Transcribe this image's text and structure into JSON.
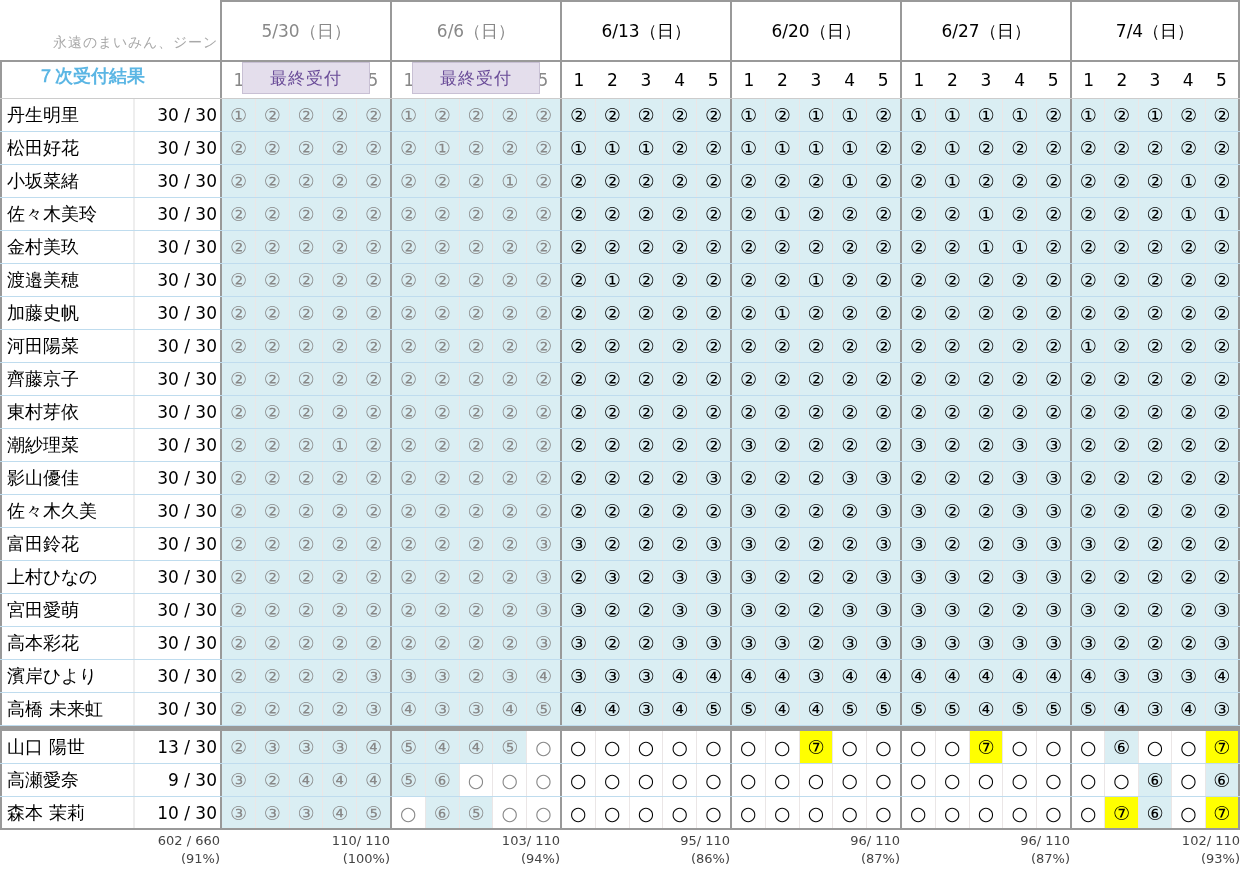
{
  "caption": "永遠のまいみん、ジーン",
  "title": "７次受付結果",
  "days": [
    {
      "label": "5/30（日）",
      "past": true,
      "slots": [
        "1",
        "5"
      ],
      "badge": "最終受付"
    },
    {
      "label": "6/6（日）",
      "past": true,
      "slots": [
        "1",
        "5"
      ],
      "badge": "最終受付"
    },
    {
      "label": "6/13（日）",
      "past": false,
      "slots": [
        "1",
        "2",
        "3",
        "4",
        "5"
      ]
    },
    {
      "label": "6/20（日）",
      "past": false,
      "slots": [
        "1",
        "2",
        "3",
        "4",
        "5"
      ]
    },
    {
      "label": "6/27（日）",
      "past": false,
      "slots": [
        "1",
        "2",
        "3",
        "4",
        "5"
      ]
    },
    {
      "label": "7/4（日）",
      "past": false,
      "slots": [
        "1",
        "2",
        "3",
        "4",
        "5"
      ]
    }
  ],
  "groups": [
    {
      "rows": [
        {
          "name": "丹生明里",
          "score": "30 / 30",
          "marks": [
            [
              "①",
              "②",
              "②",
              "②",
              "②"
            ],
            [
              "①",
              "②",
              "②",
              "②",
              "②"
            ],
            [
              "②",
              "②",
              "②",
              "②",
              "②"
            ],
            [
              "①",
              "②",
              "①",
              "①",
              "②"
            ],
            [
              "①",
              "①",
              "①",
              "①",
              "②"
            ],
            [
              "①",
              "②",
              "①",
              "②",
              "②"
            ]
          ]
        },
        {
          "name": "松田好花",
          "score": "30 / 30",
          "marks": [
            [
              "②",
              "②",
              "②",
              "②",
              "②"
            ],
            [
              "②",
              "①",
              "②",
              "②",
              "②"
            ],
            [
              "①",
              "①",
              "①",
              "②",
              "②"
            ],
            [
              "①",
              "①",
              "①",
              "①",
              "②"
            ],
            [
              "②",
              "①",
              "②",
              "②",
              "②"
            ],
            [
              "②",
              "②",
              "②",
              "②",
              "②"
            ]
          ]
        },
        {
          "name": "小坂菜緒",
          "score": "30 / 30",
          "marks": [
            [
              "②",
              "②",
              "②",
              "②",
              "②"
            ],
            [
              "②",
              "②",
              "②",
              "①",
              "②"
            ],
            [
              "②",
              "②",
              "②",
              "②",
              "②"
            ],
            [
              "②",
              "②",
              "②",
              "①",
              "②"
            ],
            [
              "②",
              "①",
              "②",
              "②",
              "②"
            ],
            [
              "②",
              "②",
              "②",
              "①",
              "②"
            ]
          ]
        },
        {
          "name": "佐々木美玲",
          "score": "30 / 30",
          "marks": [
            [
              "②",
              "②",
              "②",
              "②",
              "②"
            ],
            [
              "②",
              "②",
              "②",
              "②",
              "②"
            ],
            [
              "②",
              "②",
              "②",
              "②",
              "②"
            ],
            [
              "②",
              "①",
              "②",
              "②",
              "②"
            ],
            [
              "②",
              "②",
              "①",
              "②",
              "②"
            ],
            [
              "②",
              "②",
              "②",
              "①",
              "①"
            ]
          ]
        },
        {
          "name": "金村美玖",
          "score": "30 / 30",
          "marks": [
            [
              "②",
              "②",
              "②",
              "②",
              "②"
            ],
            [
              "②",
              "②",
              "②",
              "②",
              "②"
            ],
            [
              "②",
              "②",
              "②",
              "②",
              "②"
            ],
            [
              "②",
              "②",
              "②",
              "②",
              "②"
            ],
            [
              "②",
              "②",
              "①",
              "①",
              "②"
            ],
            [
              "②",
              "②",
              "②",
              "②",
              "②"
            ]
          ]
        },
        {
          "name": "渡邉美穂",
          "score": "30 / 30",
          "marks": [
            [
              "②",
              "②",
              "②",
              "②",
              "②"
            ],
            [
              "②",
              "②",
              "②",
              "②",
              "②"
            ],
            [
              "②",
              "①",
              "②",
              "②",
              "②"
            ],
            [
              "②",
              "②",
              "①",
              "②",
              "②"
            ],
            [
              "②",
              "②",
              "②",
              "②",
              "②"
            ],
            [
              "②",
              "②",
              "②",
              "②",
              "②"
            ]
          ]
        },
        {
          "name": "加藤史帆",
          "score": "30 / 30",
          "marks": [
            [
              "②",
              "②",
              "②",
              "②",
              "②"
            ],
            [
              "②",
              "②",
              "②",
              "②",
              "②"
            ],
            [
              "②",
              "②",
              "②",
              "②",
              "②"
            ],
            [
              "②",
              "①",
              "②",
              "②",
              "②"
            ],
            [
              "②",
              "②",
              "②",
              "②",
              "②"
            ],
            [
              "②",
              "②",
              "②",
              "②",
              "②"
            ]
          ]
        },
        {
          "name": "河田陽菜",
          "score": "30 / 30",
          "marks": [
            [
              "②",
              "②",
              "②",
              "②",
              "②"
            ],
            [
              "②",
              "②",
              "②",
              "②",
              "②"
            ],
            [
              "②",
              "②",
              "②",
              "②",
              "②"
            ],
            [
              "②",
              "②",
              "②",
              "②",
              "②"
            ],
            [
              "②",
              "②",
              "②",
              "②",
              "②"
            ],
            [
              "①",
              "②",
              "②",
              "②",
              "②"
            ]
          ]
        },
        {
          "name": "齊藤京子",
          "score": "30 / 30",
          "marks": [
            [
              "②",
              "②",
              "②",
              "②",
              "②"
            ],
            [
              "②",
              "②",
              "②",
              "②",
              "②"
            ],
            [
              "②",
              "②",
              "②",
              "②",
              "②"
            ],
            [
              "②",
              "②",
              "②",
              "②",
              "②"
            ],
            [
              "②",
              "②",
              "②",
              "②",
              "②"
            ],
            [
              "②",
              "②",
              "②",
              "②",
              "②"
            ]
          ]
        },
        {
          "name": "東村芽依",
          "score": "30 / 30",
          "marks": [
            [
              "②",
              "②",
              "②",
              "②",
              "②"
            ],
            [
              "②",
              "②",
              "②",
              "②",
              "②"
            ],
            [
              "②",
              "②",
              "②",
              "②",
              "②"
            ],
            [
              "②",
              "②",
              "②",
              "②",
              "②"
            ],
            [
              "②",
              "②",
              "②",
              "②",
              "②"
            ],
            [
              "②",
              "②",
              "②",
              "②",
              "②"
            ]
          ]
        },
        {
          "name": "潮紗理菜",
          "score": "30 / 30",
          "marks": [
            [
              "②",
              "②",
              "②",
              "①",
              "②"
            ],
            [
              "②",
              "②",
              "②",
              "②",
              "②"
            ],
            [
              "②",
              "②",
              "②",
              "②",
              "②"
            ],
            [
              "③",
              "②",
              "②",
              "②",
              "②"
            ],
            [
              "③",
              "②",
              "②",
              "③",
              "③"
            ],
            [
              "②",
              "②",
              "②",
              "②",
              "②"
            ]
          ]
        },
        {
          "name": "影山優佳",
          "score": "30 / 30",
          "marks": [
            [
              "②",
              "②",
              "②",
              "②",
              "②"
            ],
            [
              "②",
              "②",
              "②",
              "②",
              "②"
            ],
            [
              "②",
              "②",
              "②",
              "②",
              "③"
            ],
            [
              "②",
              "②",
              "②",
              "③",
              "③"
            ],
            [
              "②",
              "②",
              "②",
              "③",
              "③"
            ],
            [
              "②",
              "②",
              "②",
              "②",
              "②"
            ]
          ]
        },
        {
          "name": "佐々木久美",
          "score": "30 / 30",
          "marks": [
            [
              "②",
              "②",
              "②",
              "②",
              "②"
            ],
            [
              "②",
              "②",
              "②",
              "②",
              "②"
            ],
            [
              "②",
              "②",
              "②",
              "②",
              "②"
            ],
            [
              "③",
              "②",
              "②",
              "②",
              "③"
            ],
            [
              "③",
              "②",
              "②",
              "③",
              "③"
            ],
            [
              "②",
              "②",
              "②",
              "②",
              "②"
            ]
          ]
        },
        {
          "name": "富田鈴花",
          "score": "30 / 30",
          "marks": [
            [
              "②",
              "②",
              "②",
              "②",
              "②"
            ],
            [
              "②",
              "②",
              "②",
              "②",
              "③"
            ],
            [
              "③",
              "②",
              "②",
              "②",
              "③"
            ],
            [
              "③",
              "②",
              "②",
              "②",
              "③"
            ],
            [
              "③",
              "②",
              "②",
              "③",
              "③"
            ],
            [
              "③",
              "②",
              "②",
              "②",
              "②"
            ]
          ]
        },
        {
          "name": "上村ひなの",
          "score": "30 / 30",
          "marks": [
            [
              "②",
              "②",
              "②",
              "②",
              "②"
            ],
            [
              "②",
              "②",
              "②",
              "②",
              "③"
            ],
            [
              "②",
              "③",
              "②",
              "③",
              "③"
            ],
            [
              "③",
              "②",
              "②",
              "②",
              "③"
            ],
            [
              "③",
              "③",
              "②",
              "③",
              "③"
            ],
            [
              "②",
              "②",
              "②",
              "②",
              "②"
            ]
          ]
        },
        {
          "name": "宮田愛萌",
          "score": "30 / 30",
          "marks": [
            [
              "②",
              "②",
              "②",
              "②",
              "②"
            ],
            [
              "②",
              "②",
              "②",
              "②",
              "③"
            ],
            [
              "③",
              "②",
              "②",
              "③",
              "③"
            ],
            [
              "③",
              "②",
              "②",
              "③",
              "③"
            ],
            [
              "③",
              "③",
              "②",
              "②",
              "③"
            ],
            [
              "③",
              "②",
              "②",
              "②",
              "③"
            ]
          ]
        },
        {
          "name": "高本彩花",
          "score": "30 / 30",
          "marks": [
            [
              "②",
              "②",
              "②",
              "②",
              "②"
            ],
            [
              "②",
              "②",
              "②",
              "②",
              "③"
            ],
            [
              "③",
              "②",
              "②",
              "③",
              "③"
            ],
            [
              "③",
              "③",
              "②",
              "③",
              "③"
            ],
            [
              "③",
              "③",
              "③",
              "③",
              "③"
            ],
            [
              "③",
              "②",
              "②",
              "②",
              "③"
            ]
          ]
        },
        {
          "name": "濱岸ひより",
          "score": "30 / 30",
          "marks": [
            [
              "②",
              "②",
              "②",
              "②",
              "③"
            ],
            [
              "③",
              "③",
              "②",
              "③",
              "④"
            ],
            [
              "③",
              "③",
              "③",
              "④",
              "④"
            ],
            [
              "④",
              "④",
              "③",
              "④",
              "④"
            ],
            [
              "④",
              "④",
              "④",
              "④",
              "④"
            ],
            [
              "④",
              "③",
              "③",
              "③",
              "④"
            ]
          ]
        },
        {
          "name": "高橋 未来虹",
          "score": "30 / 30",
          "marks": [
            [
              "②",
              "②",
              "②",
              "②",
              "③"
            ],
            [
              "④",
              "③",
              "③",
              "④",
              "⑤"
            ],
            [
              "④",
              "④",
              "③",
              "④",
              "⑤"
            ],
            [
              "⑤",
              "④",
              "④",
              "⑤",
              "⑤"
            ],
            [
              "⑤",
              "⑤",
              "④",
              "⑤",
              "⑤"
            ],
            [
              "⑤",
              "④",
              "③",
              "④",
              "③"
            ]
          ]
        }
      ]
    },
    {
      "rows": [
        {
          "name": "山口 陽世",
          "score": "13 / 30",
          "marks": [
            [
              "②",
              "③",
              "③",
              "③",
              "④"
            ],
            [
              "⑤",
              "④",
              "④",
              "⑤",
              "○"
            ],
            [
              "○",
              "○",
              "○",
              "○",
              "○"
            ],
            [
              "○",
              "○",
              "⑦",
              "○",
              "○"
            ],
            [
              "○",
              "○",
              "⑦",
              "○",
              "○"
            ],
            [
              "○",
              "⑥",
              "○",
              "○",
              "⑦"
            ]
          ],
          "open": [
            [
              false,
              false,
              false,
              false,
              false
            ],
            [
              false,
              false,
              false,
              false,
              true
            ],
            [
              true,
              true,
              true,
              true,
              true
            ],
            [
              true,
              true,
              false,
              true,
              true
            ],
            [
              true,
              true,
              false,
              true,
              true
            ],
            [
              true,
              false,
              true,
              true,
              false
            ]
          ],
          "highlighted": [
            [
              false,
              false,
              false,
              false,
              false
            ],
            [
              false,
              false,
              false,
              false,
              false
            ],
            [
              false,
              false,
              false,
              false,
              false
            ],
            [
              false,
              false,
              true,
              false,
              false
            ],
            [
              false,
              false,
              true,
              false,
              false
            ],
            [
              false,
              false,
              false,
              false,
              true
            ]
          ]
        },
        {
          "name": "高瀬愛奈",
          "score": "9 / 30",
          "marks": [
            [
              "③",
              "②",
              "④",
              "④",
              "④"
            ],
            [
              "⑤",
              "⑥",
              "○",
              "○",
              "○"
            ],
            [
              "○",
              "○",
              "○",
              "○",
              "○"
            ],
            [
              "○",
              "○",
              "○",
              "○",
              "○"
            ],
            [
              "○",
              "○",
              "○",
              "○",
              "○"
            ],
            [
              "○",
              "○",
              "⑥",
              "○",
              "⑥"
            ]
          ],
          "open": [
            [
              false,
              false,
              false,
              false,
              false
            ],
            [
              false,
              false,
              true,
              true,
              true
            ],
            [
              true,
              true,
              true,
              true,
              true
            ],
            [
              true,
              true,
              true,
              true,
              true
            ],
            [
              true,
              true,
              true,
              true,
              true
            ],
            [
              true,
              true,
              false,
              true,
              false
            ]
          ],
          "highlighted": [
            [
              false,
              false,
              false,
              false,
              false
            ],
            [
              false,
              false,
              false,
              false,
              false
            ],
            [
              false,
              false,
              false,
              false,
              false
            ],
            [
              false,
              false,
              false,
              false,
              false
            ],
            [
              false,
              false,
              false,
              false,
              false
            ],
            [
              false,
              false,
              false,
              false,
              false
            ]
          ]
        },
        {
          "name": "森本 茉莉",
          "score": "10 / 30",
          "marks": [
            [
              "③",
              "③",
              "③",
              "④",
              "⑤"
            ],
            [
              "○",
              "⑥",
              "⑤",
              "○",
              "○"
            ],
            [
              "○",
              "○",
              "○",
              "○",
              "○"
            ],
            [
              "○",
              "○",
              "○",
              "○",
              "○"
            ],
            [
              "○",
              "○",
              "○",
              "○",
              "○"
            ],
            [
              "○",
              "⑦",
              "⑥",
              "○",
              "⑦"
            ]
          ],
          "open": [
            [
              false,
              false,
              false,
              false,
              false
            ],
            [
              true,
              false,
              false,
              true,
              true
            ],
            [
              true,
              true,
              true,
              true,
              true
            ],
            [
              true,
              true,
              true,
              true,
              true
            ],
            [
              true,
              true,
              true,
              true,
              true
            ],
            [
              true,
              false,
              false,
              true,
              false
            ]
          ],
          "highlighted": [
            [
              false,
              false,
              false,
              false,
              false
            ],
            [
              false,
              false,
              false,
              false,
              false
            ],
            [
              false,
              false,
              false,
              false,
              false
            ],
            [
              false,
              false,
              false,
              false,
              false
            ],
            [
              false,
              false,
              false,
              false,
              false
            ],
            [
              false,
              true,
              false,
              false,
              true
            ]
          ]
        }
      ]
    }
  ],
  "totals": {
    "overall": [
      "602 / 660",
      "(91%)"
    ],
    "days": [
      [
        "110/ 110",
        "(100%)"
      ],
      [
        "103/ 110",
        "(94%)"
      ],
      [
        "95/ 110",
        "(86%)"
      ],
      [
        "96/ 110",
        "(87%)"
      ],
      [
        "96/ 110",
        "(87%)"
      ],
      [
        "102/ 110",
        "(93%)"
      ]
    ]
  }
}
